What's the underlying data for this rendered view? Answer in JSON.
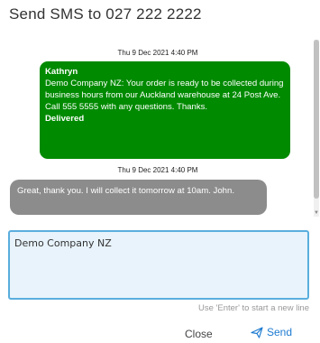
{
  "dialog": {
    "title": "Send SMS to 027 222 2222"
  },
  "thread": {
    "messages": [
      {
        "timestamp": "Thu 9 Dec 2021 4:40 PM",
        "direction": "outgoing",
        "sender": "Kathryn",
        "body": "Demo Company NZ: Your order is ready to be collected during business hours from our Auckland warehouse at 24 Post Ave. Call 555 5555 with any questions. Thanks.",
        "status": "Delivered",
        "color": "#008a00"
      },
      {
        "timestamp": "Thu 9 Dec 2021 4:40 PM",
        "direction": "incoming",
        "body": "Great, thank you. I will collect it tomorrow at 10am. John.",
        "color": "#8c8c8c"
      }
    ]
  },
  "composer": {
    "value": "Demo Company NZ",
    "hint": "Use 'Enter' to start a new line"
  },
  "actions": {
    "close_label": "Close",
    "send_label": "Send",
    "send_icon": "paper-plane-icon",
    "accent": "#1e7bd1"
  }
}
